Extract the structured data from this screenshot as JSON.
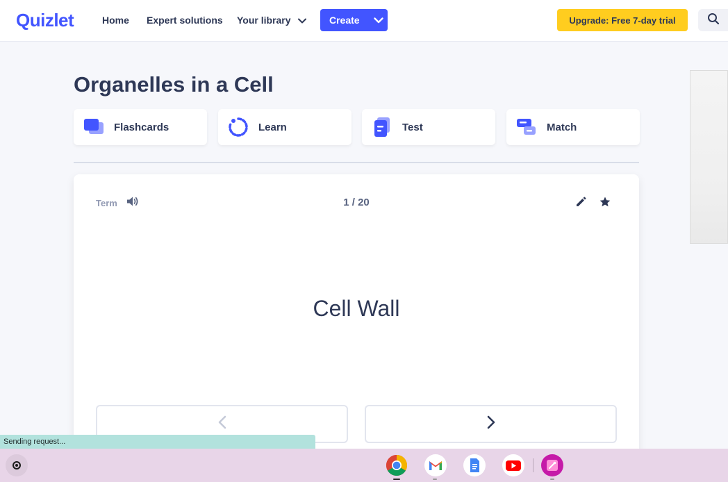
{
  "nav": {
    "logo": "Quizlet",
    "home": "Home",
    "expert_solutions": "Expert solutions",
    "your_library": "Your library",
    "create": "Create",
    "upgrade": "Upgrade: Free 7-day trial"
  },
  "set": {
    "title": "Organelles in a Cell"
  },
  "study_modes": {
    "flashcards": "Flashcards",
    "learn": "Learn",
    "test": "Test",
    "match": "Match"
  },
  "flashcard": {
    "side_label": "Term",
    "counter": "1 / 20",
    "term": "Cell Wall"
  },
  "status": {
    "text": "Sending request..."
  },
  "colors": {
    "brand": "#4255ff",
    "upgrade": "#ffcd1f",
    "text": "#2e3856",
    "background": "#f6f7fb"
  },
  "icons": {
    "library_chevron": "chevron-down-icon",
    "create_chevron": "chevron-down-icon",
    "search": "search-icon",
    "audio": "speaker-icon",
    "edit": "pencil-icon",
    "star": "star-icon",
    "prev": "chevron-left-icon",
    "next": "chevron-right-icon"
  }
}
